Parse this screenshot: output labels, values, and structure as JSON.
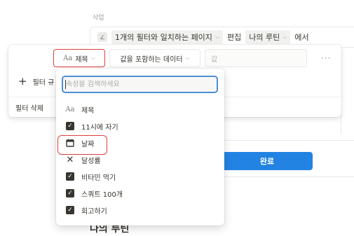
{
  "background": {
    "section_label": "삭업",
    "filter_bar": {
      "filter_count_text": "1개의 필터와 일치하는 페이지",
      "edit_label": "편집",
      "view_name": "나의 루틴",
      "suffix": "에서"
    },
    "done_button": "완료",
    "page_heading": "나의 루틴"
  },
  "filter_panel": {
    "property_select": "제목",
    "operator_select": "값을 포함하는 데이터",
    "value_placeholder": "값",
    "more_label": "···",
    "add_rule": "필터 규",
    "delete_filter": "필터 삭제"
  },
  "property_dropdown": {
    "search_placeholder": "속성을 검색하세요",
    "items": [
      {
        "label": "제목",
        "icon": "text-type-icon"
      },
      {
        "label": "11시에 자기",
        "icon": "checkbox-icon"
      },
      {
        "label": "날짜",
        "icon": "calendar-icon"
      },
      {
        "label": "달성률",
        "icon": "formula-x-icon"
      },
      {
        "label": "비타민 먹기",
        "icon": "checkbox-icon"
      },
      {
        "label": "스쿼트 100개",
        "icon": "checkbox-icon"
      },
      {
        "label": "회고하기",
        "icon": "checkbox-icon"
      }
    ]
  },
  "colors": {
    "accent_blue": "#2383e2",
    "highlight_red": "#e03e3e",
    "text": "#37352f"
  }
}
